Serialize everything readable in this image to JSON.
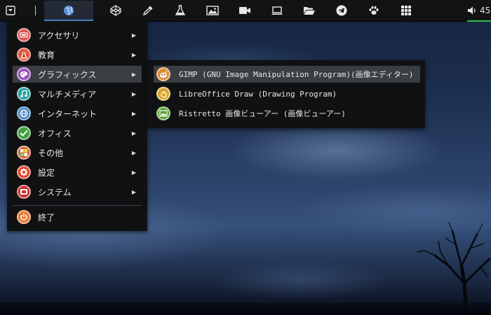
{
  "panel": {
    "launchers": [
      {
        "name": "globe-icon"
      },
      {
        "name": "codepen-icon"
      },
      {
        "name": "eyedropper-icon"
      },
      {
        "name": "flask-icon"
      },
      {
        "name": "image-icon"
      },
      {
        "name": "video-camera-icon"
      },
      {
        "name": "laptop-icon"
      },
      {
        "name": "folder-open-icon"
      },
      {
        "name": "telegram-icon"
      },
      {
        "name": "paw-icon"
      },
      {
        "name": "grid-icon"
      }
    ],
    "volume_text": "45"
  },
  "menu": {
    "categories": [
      {
        "label": "アクセサリ",
        "icon": "accessories-icon",
        "color": "#d9534f"
      },
      {
        "label": "教育",
        "icon": "education-flask-icon",
        "color": "#e2553c"
      },
      {
        "label": "グラフィックス",
        "icon": "graphics-palette-icon",
        "color": "#9b4fb8"
      },
      {
        "label": "マルチメディア",
        "icon": "multimedia-icon",
        "color": "#2aa1a0"
      },
      {
        "label": "インターネット",
        "icon": "internet-globe-icon",
        "color": "#3a7fc4"
      },
      {
        "label": "オフィス",
        "icon": "office-check-icon",
        "color": "#3f9e3f"
      },
      {
        "label": "その他",
        "icon": "other-apps-icon",
        "color": "#d6663a"
      },
      {
        "label": "設定",
        "icon": "settings-gear-icon",
        "color": "#d9452d"
      },
      {
        "label": "システム",
        "icon": "system-icon",
        "color": "#c9302c"
      }
    ],
    "quit": {
      "label": "終了",
      "icon": "quit-power-icon",
      "color": "#e8772e"
    }
  },
  "submenu": {
    "items": [
      {
        "label": "GIMP (GNU Image Manipulation Program)(画像エディター)",
        "icon": "gimp-icon",
        "color": "#e08a2c"
      },
      {
        "label": "LibreOffice Draw (Drawing Program)",
        "icon": "libreoffice-draw-icon",
        "color": "#d7a82c"
      },
      {
        "label": "Ristretto 画像ビューアー (画像ビューアー)",
        "icon": "ristretto-image-viewer-icon",
        "color": "#5aa03a"
      }
    ]
  }
}
